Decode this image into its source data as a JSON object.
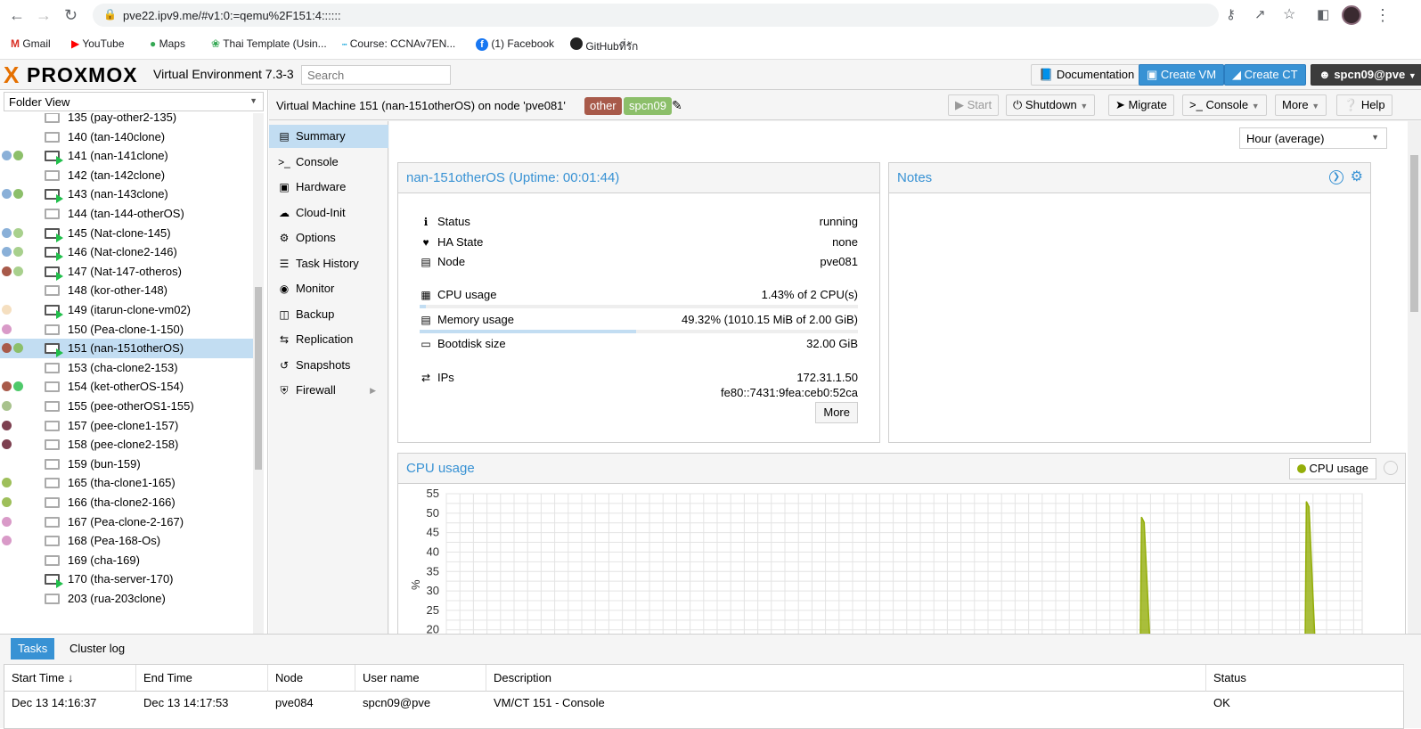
{
  "browser": {
    "url": "pve22.ipv9.me/#v1:0:=qemu%2F151:4::::::",
    "bookmarks": [
      {
        "label": "Gmail",
        "icon": "gmail-icon"
      },
      {
        "label": "YouTube",
        "icon": "youtube-icon"
      },
      {
        "label": "Maps",
        "icon": "maps-icon"
      },
      {
        "label": "Thai Template (Usin...",
        "icon": "bookmark-icon"
      },
      {
        "label": "Course: CCNAv7EN...",
        "icon": "cisco-icon"
      },
      {
        "label": "(1) Facebook",
        "icon": "facebook-icon"
      },
      {
        "label": "GitHubที่รัก",
        "icon": "github-icon"
      }
    ]
  },
  "header": {
    "logo_x": "X",
    "logo_text": "PROXMOX",
    "product": "Virtual Environment 7.3-3",
    "search_placeholder": "Search",
    "documentation": "Documentation",
    "create_vm": "Create VM",
    "create_ct": "Create CT",
    "user": "spcn09@pve"
  },
  "tree": {
    "view": "Folder View",
    "items": [
      {
        "label": "135 (pay-other2-135)",
        "running": false,
        "tags": []
      },
      {
        "label": "140 (tan-140clone)",
        "running": false,
        "tags": []
      },
      {
        "label": "141 (nan-141clone)",
        "running": true,
        "tags": [
          "#8ab0d8",
          "#8cbf6a"
        ]
      },
      {
        "label": "142 (tan-142clone)",
        "running": false,
        "tags": []
      },
      {
        "label": "143 (nan-143clone)",
        "running": true,
        "tags": [
          "#8ab0d8",
          "#8cbf6a"
        ]
      },
      {
        "label": "144 (tan-144-otherOS)",
        "running": false,
        "tags": []
      },
      {
        "label": "145 (Nat-clone-145)",
        "running": true,
        "tags": [
          "#8ab0d8",
          "#a8d08d"
        ]
      },
      {
        "label": "146 (Nat-clone2-146)",
        "running": true,
        "tags": [
          "#8ab0d8",
          "#a8d08d"
        ]
      },
      {
        "label": "147 (Nat-147-otheros)",
        "running": true,
        "tags": [
          "#a85a4a",
          "#a8d08d"
        ]
      },
      {
        "label": "148 (kor-other-148)",
        "running": false,
        "tags": []
      },
      {
        "label": "149 (itarun-clone-vm02)",
        "running": true,
        "tags": [
          "#f5dfc0"
        ]
      },
      {
        "label": "150 (Pea-clone-1-150)",
        "running": false,
        "tags": [
          "#d99ac8"
        ]
      },
      {
        "label": "151 (nan-151otherOS)",
        "running": true,
        "tags": [
          "#a85a4a",
          "#8cbf6a"
        ],
        "selected": true
      },
      {
        "label": "153 (cha-clone2-153)",
        "running": false,
        "tags": []
      },
      {
        "label": "154 (ket-otherOS-154)",
        "running": false,
        "tags": [
          "#a85a4a",
          "#4fc96a"
        ]
      },
      {
        "label": "155 (pee-otherOS1-155)",
        "running": false,
        "tags": [
          "#a8c28d"
        ]
      },
      {
        "label": "157 (pee-clone1-157)",
        "running": false,
        "tags": [
          "#7d4050"
        ]
      },
      {
        "label": "158 (pee-clone2-158)",
        "running": false,
        "tags": [
          "#7d4050"
        ]
      },
      {
        "label": "159 (bun-159)",
        "running": false,
        "tags": []
      },
      {
        "label": "165 (tha-clone1-165)",
        "running": false,
        "tags": [
          "#9ebf5a"
        ]
      },
      {
        "label": "166 (tha-clone2-166)",
        "running": false,
        "tags": [
          "#9ebf5a"
        ]
      },
      {
        "label": "167 (Pea-clone-2-167)",
        "running": false,
        "tags": [
          "#d99ac8"
        ]
      },
      {
        "label": "168 (Pea-168-Os)",
        "running": false,
        "tags": [
          "#d99ac8"
        ]
      },
      {
        "label": "169 (cha-169)",
        "running": false,
        "tags": []
      },
      {
        "label": "170 (tha-server-170)",
        "running": true,
        "tags": []
      },
      {
        "label": "203 (rua-203clone)",
        "running": false,
        "tags": []
      }
    ]
  },
  "toolbar": {
    "title": "Virtual Machine 151 (nan-151otherOS) on node 'pve081'",
    "tags": [
      {
        "label": "other",
        "color": "#a85a4a"
      },
      {
        "label": "spcn09",
        "color": "#8cbf6a"
      }
    ],
    "start": "Start",
    "shutdown": "Shutdown",
    "migrate": "Migrate",
    "console": "Console",
    "more": "More",
    "help": "Help"
  },
  "nav": [
    {
      "label": "Summary",
      "icon": "book-icon",
      "selected": true
    },
    {
      "label": "Console",
      "icon": "terminal-icon"
    },
    {
      "label": "Hardware",
      "icon": "monitor-icon"
    },
    {
      "label": "Cloud-Init",
      "icon": "cloud-icon"
    },
    {
      "label": "Options",
      "icon": "gear-icon"
    },
    {
      "label": "Task History",
      "icon": "list-icon"
    },
    {
      "label": "Monitor",
      "icon": "eye-icon"
    },
    {
      "label": "Backup",
      "icon": "floppy-icon"
    },
    {
      "label": "Replication",
      "icon": "retweet-icon"
    },
    {
      "label": "Snapshots",
      "icon": "history-icon"
    },
    {
      "label": "Firewall",
      "icon": "shield-icon"
    }
  ],
  "summary": {
    "timeframe": "Hour (average)",
    "title": "nan-151otherOS (Uptime: 00:01:44)",
    "status_label": "Status",
    "status": "running",
    "ha_label": "HA State",
    "ha": "none",
    "node_label": "Node",
    "node": "pve081",
    "cpu_label": "CPU usage",
    "cpu": "1.43% of 2 CPU(s)",
    "cpu_fraction": 0.0143,
    "mem_label": "Memory usage",
    "mem": "49.32% (1010.15 MiB of 2.00 GiB)",
    "mem_fraction": 0.4932,
    "disk_label": "Bootdisk size",
    "disk": "32.00 GiB",
    "ips_label": "IPs",
    "ip1": "172.31.1.50",
    "ip2": "fe80::7431:9fea:ceb0:52ca",
    "more": "More"
  },
  "notes": {
    "title": "Notes"
  },
  "cpu_chart_panel": {
    "title": "CPU usage",
    "legend": "CPU usage",
    "legend_color": "#94ae0a"
  },
  "chart_data": {
    "type": "area",
    "title": "CPU usage",
    "ylabel": "%",
    "yticks": [
      55,
      50,
      45,
      40,
      35,
      30,
      25,
      20
    ],
    "ylim": [
      0,
      55
    ],
    "series": [
      {
        "name": "CPU usage",
        "color": "#94ae0a",
        "spikes": [
          {
            "x_frac": 0.76,
            "peak": 49
          },
          {
            "x_frac": 0.94,
            "peak": 53
          }
        ]
      }
    ]
  },
  "bottom": {
    "tab_tasks": "Tasks",
    "tab_log": "Cluster log",
    "columns": [
      "Start Time ↓",
      "End Time",
      "Node",
      "User name",
      "Description",
      "Status"
    ],
    "rows": [
      [
        "Dec 13 14:16:37",
        "Dec 13 14:17:53",
        "pve084",
        "spcn09@pve",
        "VM/CT 151 - Console",
        "OK"
      ]
    ]
  }
}
